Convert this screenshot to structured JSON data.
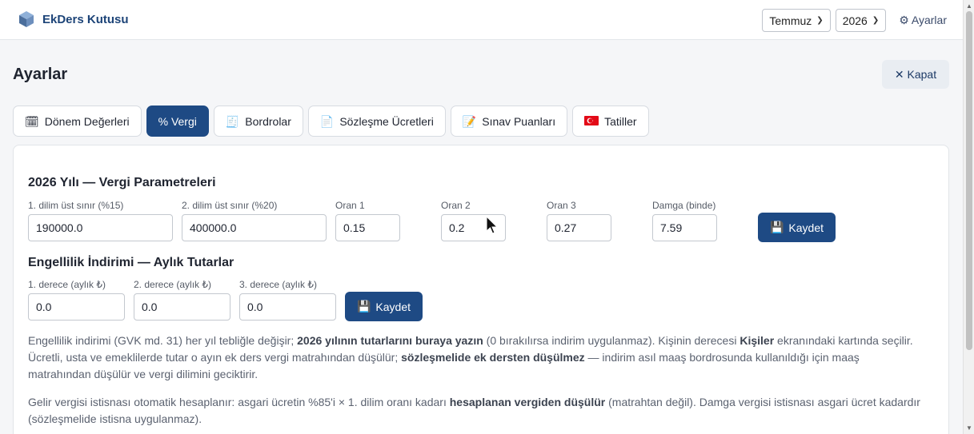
{
  "app": {
    "name": "EkDers Kutusu",
    "icon": "cube-icon"
  },
  "header": {
    "month": "Temmuz",
    "year": "2026",
    "settings_label": "⚙ Ayarlar"
  },
  "page": {
    "title": "Ayarlar",
    "close_label": "✕ Kapat"
  },
  "tabs": [
    {
      "icon": "🗓",
      "label": "Dönem Değerleri",
      "active": false
    },
    {
      "icon": "",
      "label": "% Vergi",
      "active": true
    },
    {
      "icon": "🧾",
      "label": "Bordrolar",
      "active": false
    },
    {
      "icon": "📄",
      "label": "Sözleşme Ücretleri",
      "active": false
    },
    {
      "icon": "📝",
      "label": "Sınav Puanları",
      "active": false
    },
    {
      "icon": "🇹🇷",
      "label": "Tatiller",
      "active": false
    }
  ],
  "tax": {
    "title": "2026 Yılı — Vergi Parametreleri",
    "fields": [
      {
        "label": "1. dilim üst sınır (%15)",
        "value": "190000.0"
      },
      {
        "label": "2. dilim üst sınır (%20)",
        "value": "400000.0"
      },
      {
        "label": "Oran 1",
        "value": "0.15"
      },
      {
        "label": "Oran 2",
        "value": "0.2"
      },
      {
        "label": "Oran 3",
        "value": "0.27"
      },
      {
        "label": "Damga (binde)",
        "value": "7.59"
      }
    ],
    "save_label": "Kaydet"
  },
  "disability": {
    "title": "Engellilik İndirimi — Aylık Tutarlar",
    "fields": [
      {
        "label": "1. derece (aylık ₺)",
        "value": "0.0"
      },
      {
        "label": "2. derece (aylık ₺)",
        "value": "0.0"
      },
      {
        "label": "3. derece (aylık ₺)",
        "value": "0.0"
      }
    ],
    "save_label": "Kaydet"
  },
  "notes": {
    "n1_a": "Engellilik indirimi (GVK md. 31) her yıl tebliğle değişir; ",
    "n1_b": "2026 yılının tutarlarını buraya yazın",
    "n1_c": " (0 bırakılırsa indirim uygulanmaz). Kişinin derecesi ",
    "n1_d": "Kişiler",
    "n1_e": " ekranındaki kartında seçilir. Ücretli, usta ve emeklilerde tutar o ayın ek ders vergi matrahından düşülür; ",
    "n1_f": "sözleşmelide ek dersten düşülmez",
    "n1_g": " — indirim asıl maaş bordrosunda kullanıldığı için maaş matrahından düşülür ve vergi dilimini geciktirir.",
    "n2_a": "Gelir vergisi istisnası otomatik hesaplanır: asgari ücretin %85'i × 1. dilim oranı kadarı ",
    "n2_b": "hesaplanan vergiden düşülür",
    "n2_c": " (matrahtan değil). Damga vergisi istisnası asgari ücret kadardır (sözleşmelide istisna uygulanmaz)."
  }
}
